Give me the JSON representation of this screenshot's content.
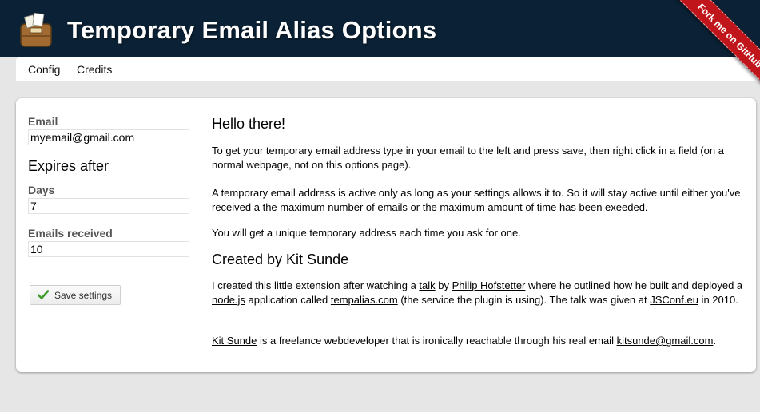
{
  "header": {
    "title": "Temporary Email Alias Options",
    "logo_icon": "briefcase-icon",
    "ribbon_label": "Fork me on GitHub",
    "ribbon_color": "#c0161b",
    "bg_color": "#0b2236"
  },
  "nav": {
    "items": [
      {
        "label": "Config"
      },
      {
        "label": "Credits"
      }
    ]
  },
  "form": {
    "email_label": "Email",
    "email_value": "myemail@gmail.com",
    "expires_heading": "Expires after",
    "days_label": "Days",
    "days_value": "7",
    "emails_label": "Emails received",
    "emails_value": "10",
    "save_label": "Save settings",
    "save_icon": "checkmark-icon"
  },
  "content": {
    "hello_heading": "Hello there!",
    "para1": "To get your temporary email address type in your email to the left and press save, then right click in a field (on a normal webpage, not on this options page).",
    "para2": "A temporary email address is active only as long as your settings allows it to. So it will stay active until either you've received a the maximum number of emails or the maximum amount of time has been exeeded.",
    "para3": "You will get a unique temporary address each time you ask for one.",
    "credits_heading": "Created by Kit Sunde",
    "credits_para": {
      "t1": "I created this little extension after watching a ",
      "link_talk": "talk",
      "t2": " by ",
      "link_philip": "Philip Hofstetter",
      "t3": " where he outlined how he built and deployed a ",
      "link_node": "node.js",
      "t4": " application called ",
      "link_tempalias": "tempalias.com",
      "t5": " (the service the plugin is using). The talk was given at ",
      "link_jsconf": "JSConf.eu",
      "t6": " in 2010."
    },
    "bio_para": {
      "link_kit": "Kit Sunde",
      "t1": " is a freelance webdeveloper that is ironically reachable through his real email ",
      "link_email": "kitsunde@gmail.com",
      "t2": "."
    }
  }
}
